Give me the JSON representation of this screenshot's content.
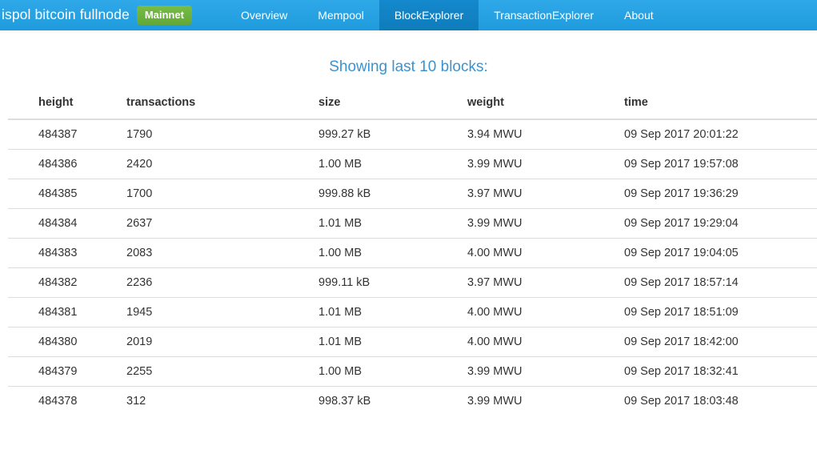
{
  "navbar": {
    "brand_text": "ispol bitcoin fullnode",
    "network_badge": "Mainnet",
    "links": [
      {
        "label": "Overview",
        "active": false
      },
      {
        "label": "Mempool",
        "active": false
      },
      {
        "label": "BlockExplorer",
        "active": true
      },
      {
        "label": "TransactionExplorer",
        "active": false
      },
      {
        "label": "About",
        "active": false
      }
    ],
    "colors": {
      "background": "#28a2e4",
      "active_tab": "#1184c7",
      "badge": "#6cb33f",
      "text": "#ffffff"
    }
  },
  "main": {
    "heading": "Showing last 10 blocks:",
    "heading_color": "#3a93d0",
    "table": {
      "columns": [
        "height",
        "transactions",
        "size",
        "weight",
        "time"
      ],
      "rows": [
        {
          "height": "484387",
          "transactions": "1790",
          "size": "999.27 kB",
          "weight": "3.94 MWU",
          "time": "09 Sep 2017 20:01:22"
        },
        {
          "height": "484386",
          "transactions": "2420",
          "size": "1.00 MB",
          "weight": "3.99 MWU",
          "time": "09 Sep 2017 19:57:08"
        },
        {
          "height": "484385",
          "transactions": "1700",
          "size": "999.88 kB",
          "weight": "3.97 MWU",
          "time": "09 Sep 2017 19:36:29"
        },
        {
          "height": "484384",
          "transactions": "2637",
          "size": "1.01 MB",
          "weight": "3.99 MWU",
          "time": "09 Sep 2017 19:29:04"
        },
        {
          "height": "484383",
          "transactions": "2083",
          "size": "1.00 MB",
          "weight": "4.00 MWU",
          "time": "09 Sep 2017 19:04:05"
        },
        {
          "height": "484382",
          "transactions": "2236",
          "size": "999.11 kB",
          "weight": "3.97 MWU",
          "time": "09 Sep 2017 18:57:14"
        },
        {
          "height": "484381",
          "transactions": "1945",
          "size": "1.01 MB",
          "weight": "4.00 MWU",
          "time": "09 Sep 2017 18:51:09"
        },
        {
          "height": "484380",
          "transactions": "2019",
          "size": "1.01 MB",
          "weight": "4.00 MWU",
          "time": "09 Sep 2017 18:42:00"
        },
        {
          "height": "484379",
          "transactions": "2255",
          "size": "1.00 MB",
          "weight": "3.99 MWU",
          "time": "09 Sep 2017 18:32:41"
        },
        {
          "height": "484378",
          "transactions": "312",
          "size": "998.37 kB",
          "weight": "3.99 MWU",
          "time": "09 Sep 2017 18:03:48"
        }
      ]
    }
  }
}
